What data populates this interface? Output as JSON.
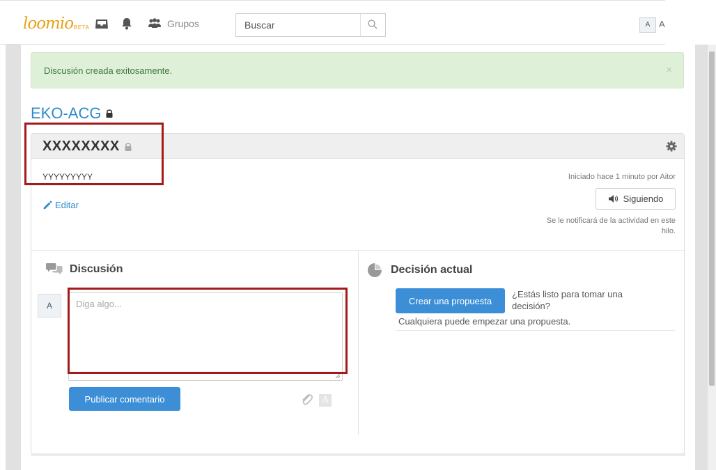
{
  "header": {
    "logo_text": "loomio",
    "logo_badge": "BETA",
    "groups_label": "Grupos",
    "search_placeholder": "Buscar",
    "avatar_initial": "A",
    "user_initial": "A"
  },
  "flash": {
    "message": "Discusión creada exitosamente.",
    "close_symbol": "×",
    "color": "#dff0d8"
  },
  "group": {
    "name": "EKO-ACG",
    "private": true
  },
  "thread": {
    "title": "XXXXXXXX",
    "private": true,
    "description": "YYYYYYYYY",
    "edit_label": "Editar",
    "started_text": "Iniciado hace 1 minuto por Aitor",
    "follow_label": "Siguiendo",
    "follow_note": "Se le notificará de la actividad en este hilo."
  },
  "discussion": {
    "heading": "Discusión",
    "avatar_initial": "A",
    "comment_placeholder": "Diga algo...",
    "publish_label": "Publicar comentario",
    "format_glyph": "A"
  },
  "decision": {
    "heading": "Decisión actual",
    "create_label": "Crear una propuesta",
    "ready_question": "¿Estás listo para tomar una decisión?",
    "anyone_text": "Cualquiera puede empezar una propuesta."
  },
  "colors": {
    "accent": "#3c8fd6",
    "link": "#2e8bc9",
    "brand": "#e6a21a",
    "highlight": "#a31a1a"
  }
}
